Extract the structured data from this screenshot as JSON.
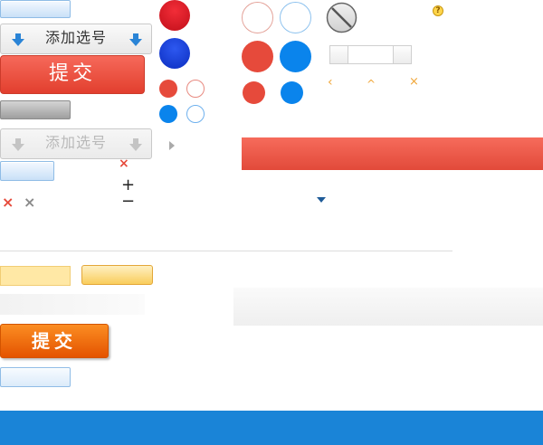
{
  "buttons": {
    "add_option_label": "添加选号",
    "add_option_disabled_label": "添加选号",
    "submit_label": "提交",
    "submit_orange_label": "提交"
  },
  "symbols": {
    "plus": "+",
    "minus": "−",
    "close_red": "×",
    "close_gray": "×",
    "close_orange": "×",
    "chevron_left": "‹",
    "chevron_up": "^",
    "help": "?"
  },
  "icons": {
    "close": "close-icon",
    "arrow_down": "arrow-down-icon",
    "caret_right": "caret-right-icon",
    "caret_down": "caret-down-icon",
    "forbidden": "forbidden-icon",
    "help": "help-icon"
  },
  "colors": {
    "red": "#e64a3b",
    "blue": "#0a84ec",
    "orange": "#f07a12",
    "footer_blue": "#1a84d7",
    "gray_icon": "#8a8a8a"
  }
}
